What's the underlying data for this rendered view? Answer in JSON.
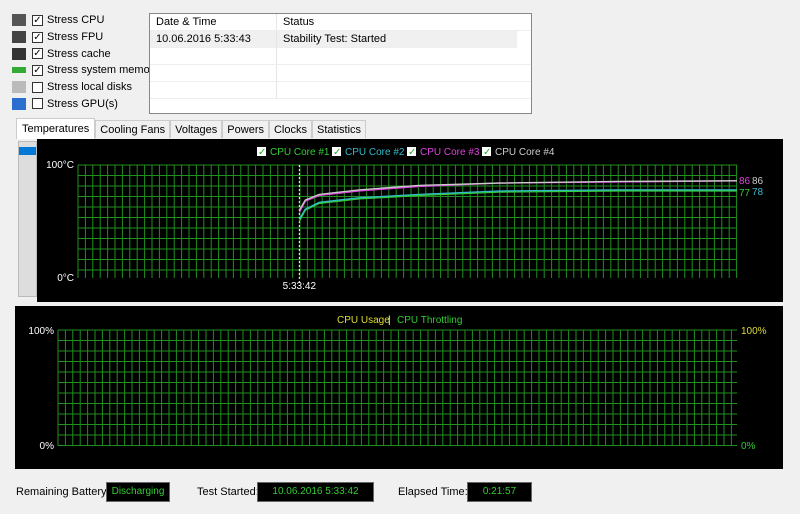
{
  "options": [
    {
      "label": "Stress CPU",
      "checked": true,
      "icon": "cpu-icon"
    },
    {
      "label": "Stress FPU",
      "checked": true,
      "icon": "fpu-icon"
    },
    {
      "label": "Stress cache",
      "checked": true,
      "icon": "cache-icon"
    },
    {
      "label": "Stress system memory",
      "checked": true,
      "icon": "memory-icon"
    },
    {
      "label": "Stress local disks",
      "checked": false,
      "icon": "disk-icon"
    },
    {
      "label": "Stress GPU(s)",
      "checked": false,
      "icon": "gpu-icon"
    }
  ],
  "log": {
    "headers": [
      "Date & Time",
      "Status"
    ],
    "rows": [
      [
        "10.06.2016 5:33:43",
        "Stability Test: Started"
      ]
    ]
  },
  "tabs": [
    "Temperatures",
    "Cooling Fans",
    "Voltages",
    "Powers",
    "Clocks",
    "Statistics"
  ],
  "active_tab": "Temperatures",
  "chart_data": [
    {
      "type": "line",
      "title": "Temperatures",
      "ylim": [
        0,
        100
      ],
      "ytick_labels": [
        "100°C",
        "0°C"
      ],
      "xlim": [
        -11.1,
        21.95
      ],
      "x_unit": "minutes since start",
      "marker_label": "5:33:42",
      "grid": true,
      "series": [
        {
          "name": "CPU Core #1",
          "color": "#33cc33",
          "end_label": "77",
          "points": [
            [
              0,
              50
            ],
            [
              0.3,
              60
            ],
            [
              1,
              66
            ],
            [
              3,
              70
            ],
            [
              6,
              73
            ],
            [
              10,
              76
            ],
            [
              16,
              77
            ],
            [
              21.95,
              77
            ]
          ]
        },
        {
          "name": "CPU Core #2",
          "color": "#33bbcc",
          "end_label": "78",
          "points": [
            [
              0,
              52
            ],
            [
              0.3,
              61
            ],
            [
              1,
              67
            ],
            [
              3,
              71
            ],
            [
              6,
              74
            ],
            [
              10,
              77
            ],
            [
              16,
              78
            ],
            [
              21.95,
              78
            ]
          ]
        },
        {
          "name": "CPU Core #3",
          "color": "#dd44dd",
          "end_label": "86",
          "points": [
            [
              0,
              58
            ],
            [
              0.3,
              68
            ],
            [
              1,
              73
            ],
            [
              3,
              77
            ],
            [
              6,
              81
            ],
            [
              10,
              84
            ],
            [
              16,
              85
            ],
            [
              21.95,
              86
            ]
          ]
        },
        {
          "name": "CPU Core #4",
          "color": "#cccccc",
          "end_label": "86",
          "points": [
            [
              0,
              60
            ],
            [
              0.3,
              69
            ],
            [
              1,
              74
            ],
            [
              3,
              78
            ],
            [
              6,
              82
            ],
            [
              10,
              84
            ],
            [
              16,
              85.5
            ],
            [
              21.95,
              86
            ]
          ]
        }
      ]
    },
    {
      "type": "line",
      "title": "CPU Usage | CPU Throttling",
      "legend": [
        {
          "name": "CPU Usage",
          "color": "#dddd33"
        },
        {
          "name": "CPU Throttling",
          "color": "#33cc33"
        }
      ],
      "ylim": [
        0,
        100
      ],
      "left_labels": [
        "100%",
        "0%"
      ],
      "right_labels": [
        "100%",
        "0%"
      ],
      "grid": true,
      "series": []
    }
  ],
  "status": {
    "battery_label": "Remaining Battery:",
    "battery_value": "Discharging",
    "started_label": "Test Started:",
    "started_value": "10.06.2016 5:33:42",
    "elapsed_label": "Elapsed Time:",
    "elapsed_value": "0:21:57"
  }
}
